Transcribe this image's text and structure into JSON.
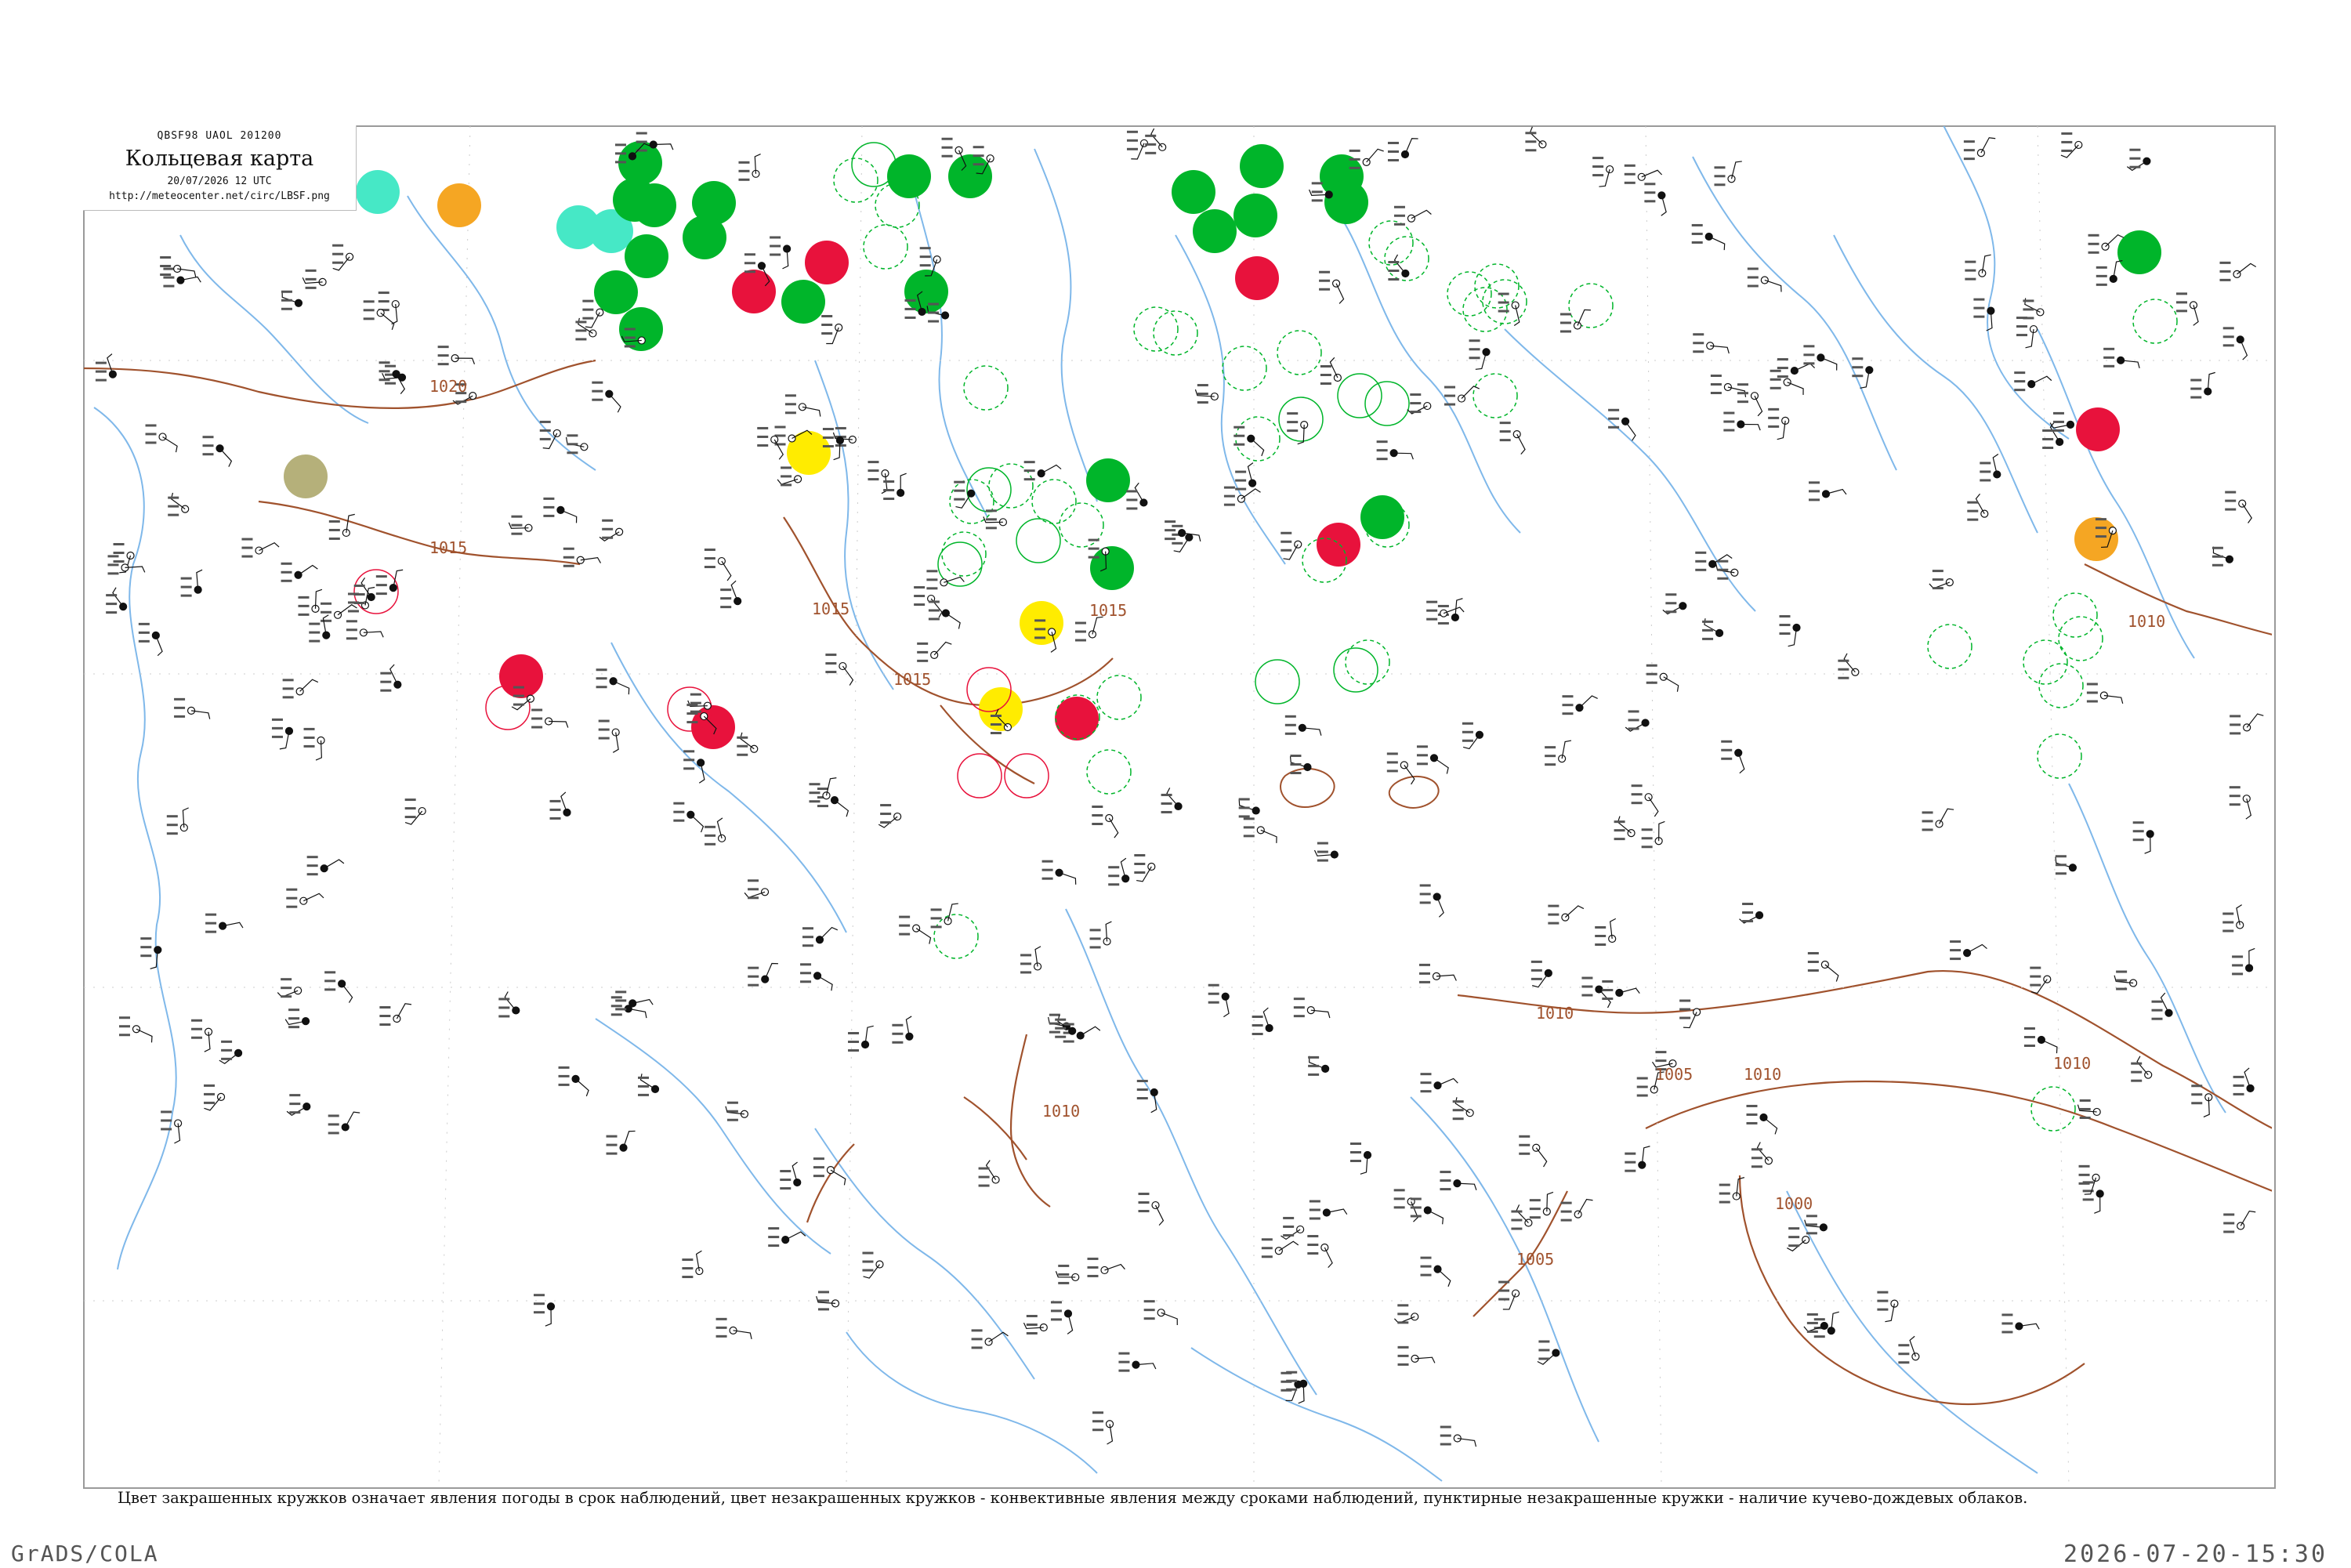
{
  "header": {
    "code_line": "QBSF98  UAOL  201200",
    "title": "Кольцевая карта",
    "date_line": "20/07/2026 12 UTC",
    "url": "http://meteocenter.net/circ/LBSF.png"
  },
  "legend_note": "Цвет закрашенных кружков означает явления погоды в срок наблюдений, цвет незакрашенных кружков - конвективные явления между сроками наблюдений, пунктирные незакрашенные кружки - наличие кучево-дождевых облаков.",
  "footer": {
    "left": "GrADS/COLA",
    "right": "2026-07-20-15:30"
  },
  "colors": {
    "rain": "#00b52a",
    "thunder": "#e8123c",
    "drizzle": "#46e8c6",
    "fog": "#ffec00",
    "haze": "#f5a623",
    "dust": "#b5b07a",
    "isobar": "#a0522d",
    "river": "#7fb8ea",
    "border": "#9a9a9a"
  },
  "isobars": [
    {
      "label": "1020"
    },
    {
      "label": "1015"
    },
    {
      "label": "1015"
    },
    {
      "label": "1015"
    },
    {
      "label": "1015"
    },
    {
      "label": "1010"
    },
    {
      "label": "1010"
    },
    {
      "label": "1010"
    },
    {
      "label": "1010"
    },
    {
      "label": "1010"
    },
    {
      "label": "1005"
    },
    {
      "label": "1005"
    },
    {
      "label": "1000"
    }
  ]
}
